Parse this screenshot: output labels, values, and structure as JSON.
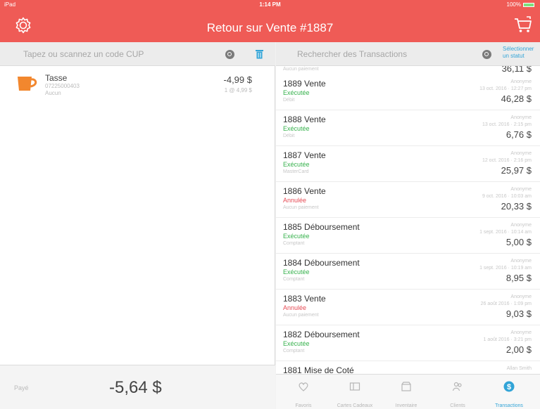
{
  "status_bar": {
    "device": "iPad",
    "time": "1:14 PM",
    "battery": "100%"
  },
  "header": {
    "title": "Retour sur Vente #1887"
  },
  "left_panel": {
    "search": {
      "placeholder": "Tapez ou scannez un code CUP"
    },
    "items": [
      {
        "name": "Tasse",
        "sku": "07225000403",
        "category": "Aucun",
        "price": "-4,99 $",
        "qty": "1 @ 4,99 $"
      }
    ],
    "footer": {
      "label": "Payé",
      "total": "-5,64 $"
    }
  },
  "right_panel": {
    "search": {
      "placeholder": "Rechercher des Transactions",
      "status_select": "Sélectionner un statut"
    },
    "top_partial": {
      "payment": "Aucun paiement",
      "amount": "36,11 $"
    },
    "transactions": [
      {
        "title": "1889 Vente",
        "status": "Exécutée",
        "status_kind": "ok",
        "payment": "Débit",
        "user": "Anonyme",
        "date": "13 oct. 2016 · 12:27 pm",
        "amount": "46,28 $"
      },
      {
        "title": "1888 Vente",
        "status": "Exécutée",
        "status_kind": "ok",
        "payment": "Débit",
        "user": "Anonyme",
        "date": "13 oct. 2016 · 2:15 pm",
        "amount": "6,76 $"
      },
      {
        "title": "1887 Vente",
        "status": "Exécutée",
        "status_kind": "ok",
        "payment": "MasterCard",
        "user": "Anonyme",
        "date": "12 oct. 2016 · 2:16 pm",
        "amount": "25,97 $"
      },
      {
        "title": "1886 Vente",
        "status": "Annulée",
        "status_kind": "void",
        "payment": "Aucun paiement",
        "user": "Anonyme",
        "date": "9 oct. 2016 · 10:03 am",
        "amount": "20,33 $"
      },
      {
        "title": "1885 Déboursement",
        "status": "Exécutée",
        "status_kind": "ok",
        "payment": "Comptant",
        "user": "Anonyme",
        "date": "1 sept. 2016 · 10:14 am",
        "amount": "5,00 $"
      },
      {
        "title": "1884 Déboursement",
        "status": "Exécutée",
        "status_kind": "ok",
        "payment": "Comptant",
        "user": "Anonyme",
        "date": "1 sept. 2016 · 10:19 am",
        "amount": "8,95 $"
      },
      {
        "title": "1883 Vente",
        "status": "Annulée",
        "status_kind": "void",
        "payment": "Aucun paiement",
        "user": "Anonyme",
        "date": "26 août 2016 · 1:09 pm",
        "amount": "9,03 $"
      },
      {
        "title": "1882 Déboursement",
        "status": "Exécutée",
        "status_kind": "ok",
        "payment": "Comptant",
        "user": "Anonyme",
        "date": "1 août 2016 · 3:21 pm",
        "amount": "2,00 $"
      },
      {
        "title": "1881 Mise de Coté",
        "status": "",
        "status_kind": "ok",
        "payment": "",
        "user": "Allan Smith",
        "date": "",
        "amount": ""
      }
    ],
    "tabs": [
      {
        "label": "Favoris",
        "icon": "heart-icon"
      },
      {
        "label": "Cartes Cadeaux",
        "icon": "gift-card-icon"
      },
      {
        "label": "Inventaire",
        "icon": "inventory-icon"
      },
      {
        "label": "Clients",
        "icon": "customers-icon"
      },
      {
        "label": "Transactions",
        "icon": "dollar-icon",
        "active": true
      }
    ]
  },
  "colors": {
    "brand": "#ef5b56",
    "accent": "#32a4d7",
    "success": "#37b24d",
    "void": "#e64b55"
  }
}
